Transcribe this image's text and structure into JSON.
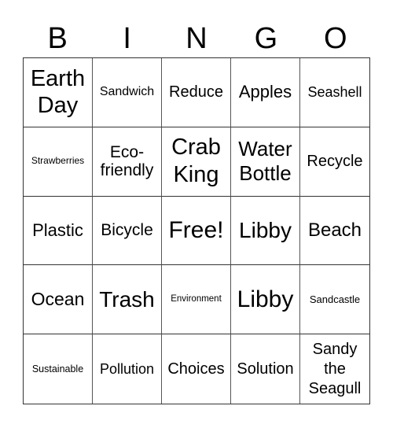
{
  "header": {
    "letters": [
      "B",
      "I",
      "N",
      "G",
      "O"
    ]
  },
  "cells": [
    [
      "Earth Day",
      "Sandwich",
      "Reduce",
      "Apples",
      "Seashell"
    ],
    [
      "Strawberries",
      "Eco-friendly",
      "Crab King",
      "Water Bottle",
      "Recycle"
    ],
    [
      "Plastic",
      "Bicycle",
      "Free!",
      "Libby",
      "Beach"
    ],
    [
      "Ocean",
      "Trash",
      "Environment",
      "Libby",
      "Sandcastle"
    ],
    [
      "Sustainable",
      "Pollution",
      "Choices",
      "Solution",
      "Sandy the Seagull"
    ]
  ]
}
